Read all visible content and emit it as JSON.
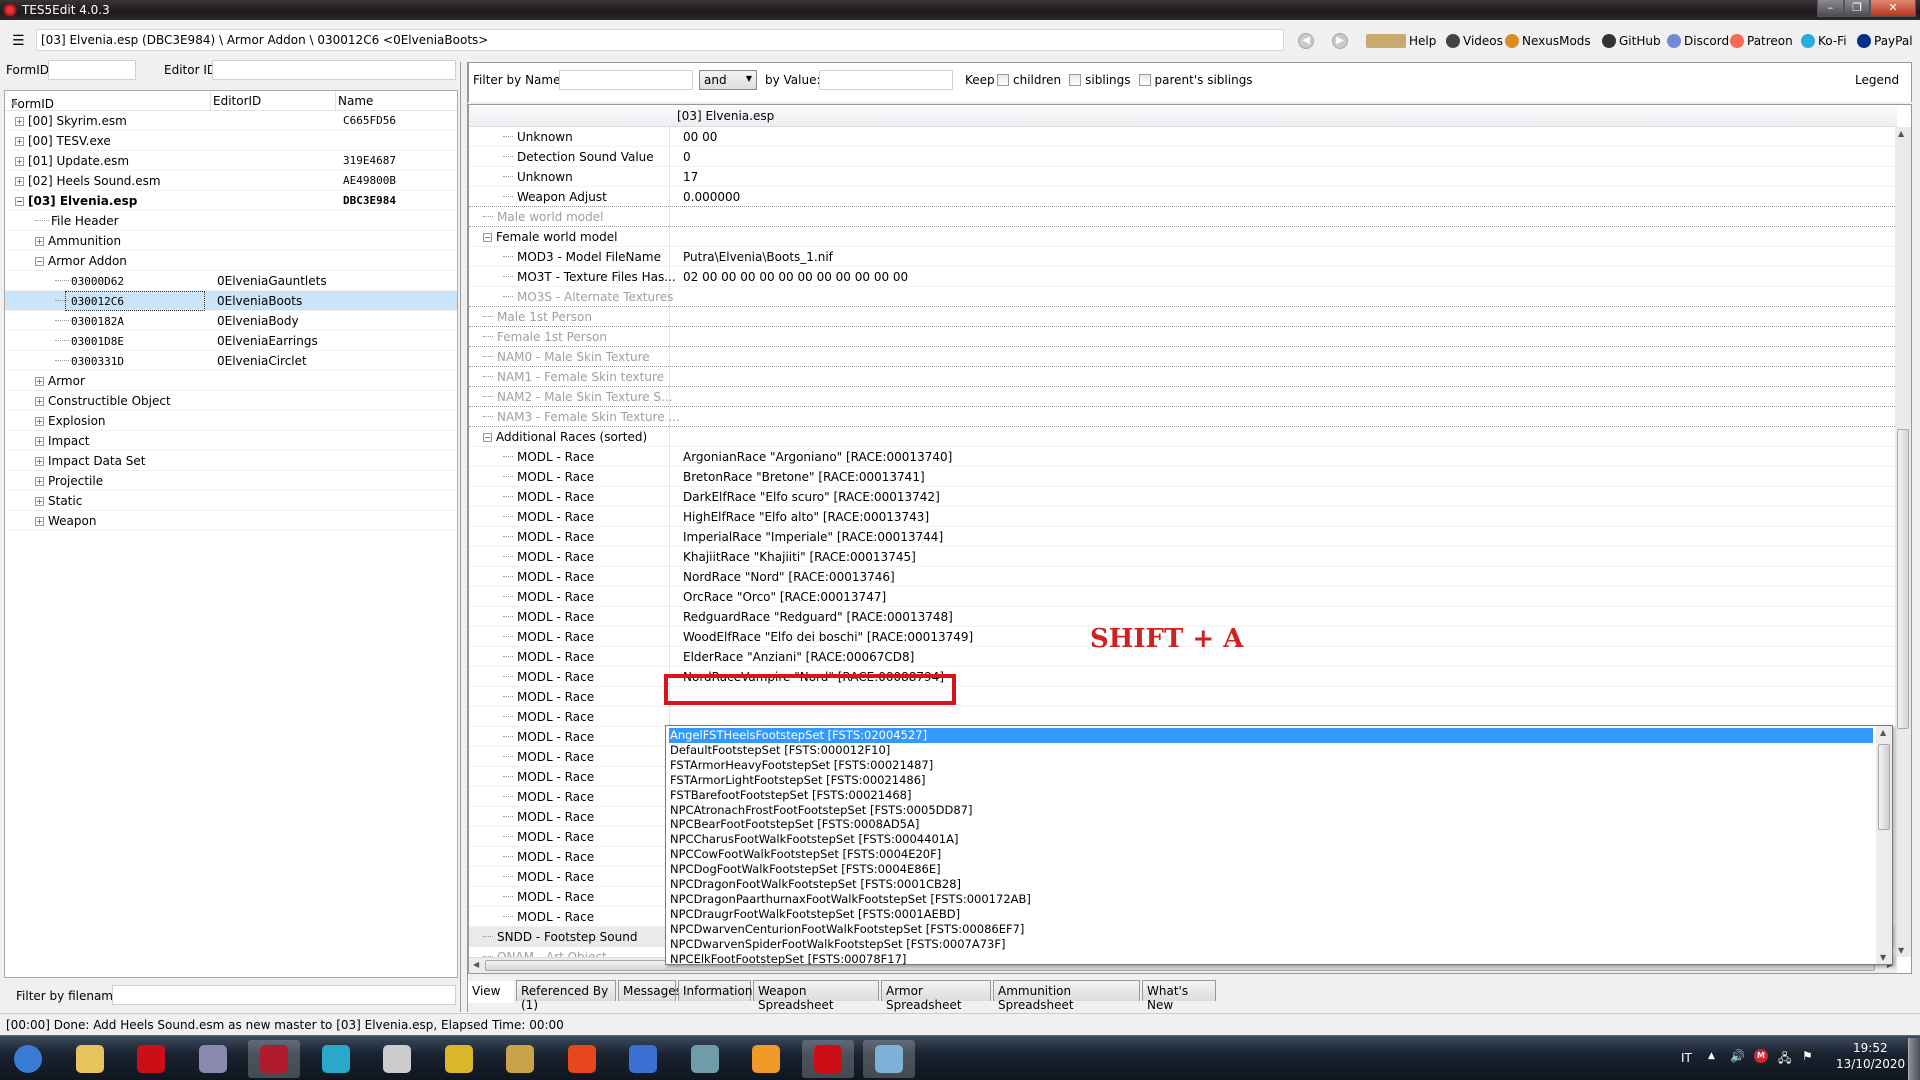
{
  "window": {
    "title": "TES5Edit 4.0.3"
  },
  "toolbar": {
    "path": "[03] Elvenia.esp (DBC3E984) \\ Armor Addon \\ 030012C6 <0ElveniaBoots>",
    "menu_glyph": "☰",
    "back_glyph": "◀",
    "forward_glyph": "▶",
    "links": [
      {
        "label": "Help",
        "icon": "book-icon",
        "color": "#c8a96e"
      },
      {
        "label": "Videos",
        "icon": "videos-icon",
        "color": "#444444"
      },
      {
        "label": "NexusMods",
        "icon": "nexusmods-icon",
        "color": "#d98c1f"
      },
      {
        "label": "GitHub",
        "icon": "github-icon",
        "color": "#333333"
      },
      {
        "label": "Discord",
        "icon": "discord-icon",
        "color": "#7289da"
      },
      {
        "label": "Patreon",
        "icon": "patreon-icon",
        "color": "#f96854"
      },
      {
        "label": "Ko-Fi",
        "icon": "kofi-icon",
        "color": "#29abe0"
      },
      {
        "label": "PayPal",
        "icon": "paypal-icon",
        "color": "#003087"
      }
    ]
  },
  "left": {
    "formid_label": "FormID",
    "editorid_label": "Editor ID",
    "formid_value": "",
    "editorid_value": "",
    "columns": [
      "FormID",
      "EditorID",
      "Name"
    ],
    "sort_glyph": "▲",
    "rows": [
      {
        "indent": 0,
        "exp": "+",
        "label": "[00] Skyrim.esm",
        "editor": "",
        "name": "C665FD56"
      },
      {
        "indent": 0,
        "exp": "+",
        "label": "[00] TESV.exe",
        "editor": "",
        "name": ""
      },
      {
        "indent": 0,
        "exp": "+",
        "label": "[01] Update.esm",
        "editor": "",
        "name": "319E4687"
      },
      {
        "indent": 0,
        "exp": "+",
        "label": "[02] Heels Sound.esm",
        "editor": "",
        "name": "AE49800B"
      },
      {
        "indent": 0,
        "exp": "-",
        "label": "[03] Elvenia.esp",
        "editor": "",
        "name": "DBC3E984",
        "bold": true
      },
      {
        "indent": 1,
        "exp": "",
        "label": "File Header",
        "editor": "",
        "name": ""
      },
      {
        "indent": 1,
        "exp": "+",
        "label": "Ammunition",
        "editor": "",
        "name": ""
      },
      {
        "indent": 1,
        "exp": "-",
        "label": "Armor Addon",
        "editor": "",
        "name": ""
      },
      {
        "indent": 2,
        "exp": "",
        "label": "03000D62",
        "editor": "0ElveniaGauntlets",
        "name": "",
        "mono": true
      },
      {
        "indent": 2,
        "exp": "",
        "label": "030012C6",
        "editor": "0ElveniaBoots",
        "name": "",
        "mono": true,
        "selected": true
      },
      {
        "indent": 2,
        "exp": "",
        "label": "0300182A",
        "editor": "0ElveniaBody",
        "name": "",
        "mono": true
      },
      {
        "indent": 2,
        "exp": "",
        "label": "03001D8E",
        "editor": "0ElveniaEarrings",
        "name": "",
        "mono": true
      },
      {
        "indent": 2,
        "exp": "",
        "label": "0300331D",
        "editor": "0ElveniaCirclet",
        "name": "",
        "mono": true
      },
      {
        "indent": 1,
        "exp": "+",
        "label": "Armor",
        "editor": "",
        "name": ""
      },
      {
        "indent": 1,
        "exp": "+",
        "label": "Constructible Object",
        "editor": "",
        "name": ""
      },
      {
        "indent": 1,
        "exp": "+",
        "label": "Explosion",
        "editor": "",
        "name": ""
      },
      {
        "indent": 1,
        "exp": "+",
        "label": "Impact",
        "editor": "",
        "name": ""
      },
      {
        "indent": 1,
        "exp": "+",
        "label": "Impact Data Set",
        "editor": "",
        "name": ""
      },
      {
        "indent": 1,
        "exp": "+",
        "label": "Projectile",
        "editor": "",
        "name": ""
      },
      {
        "indent": 1,
        "exp": "+",
        "label": "Static",
        "editor": "",
        "name": ""
      },
      {
        "indent": 1,
        "exp": "+",
        "label": "Weapon",
        "editor": "",
        "name": ""
      }
    ],
    "filter_label": "Filter by filename:",
    "filter_value": ""
  },
  "right": {
    "filter_name_label": "Filter by Name:",
    "filter_name_value": "",
    "combinator": "and",
    "filter_value_label": "by Value:",
    "filter_value_value": "",
    "keep_label": "Keep",
    "checkboxes": [
      {
        "label": "children",
        "checked": false
      },
      {
        "label": "siblings",
        "checked": false
      },
      {
        "label": "parent's siblings",
        "checked": false
      }
    ],
    "legend_label": "Legend",
    "column_header": "[03] Elvenia.esp",
    "rows": [
      {
        "indent": 2,
        "name": "Unknown",
        "value": "00 00"
      },
      {
        "indent": 2,
        "name": "Detection Sound Value",
        "value": "0"
      },
      {
        "indent": 2,
        "name": "Unknown",
        "value": "17"
      },
      {
        "indent": 2,
        "name": "Weapon Adjust",
        "value": "0.000000",
        "sep": true
      },
      {
        "indent": 1,
        "name": "Male world model",
        "value": "",
        "dim": true,
        "sep": true
      },
      {
        "indent": 1,
        "name": "Female world model",
        "value": "",
        "exp": "-"
      },
      {
        "indent": 2,
        "name": "MOD3 - Model FileName",
        "value": "Putra\\Elvenia\\Boots_1.nif"
      },
      {
        "indent": 2,
        "name": "MO3T - Texture Files Has...",
        "value": "02 00 00 00 00 00 00 00 00 00 00 00"
      },
      {
        "indent": 2,
        "name": "MO3S - Alternate Textures",
        "value": "",
        "dim": true,
        "sep": true
      },
      {
        "indent": 1,
        "name": "Male 1st Person",
        "value": "",
        "dim": true,
        "sep": true
      },
      {
        "indent": 1,
        "name": "Female 1st Person",
        "value": "",
        "dim": true,
        "sep": true
      },
      {
        "indent": 1,
        "name": "NAM0 - Male Skin Texture",
        "value": "",
        "dim": true,
        "sep": true
      },
      {
        "indent": 1,
        "name": "NAM1 - Female Skin texture",
        "value": "",
        "dim": true,
        "sep": true
      },
      {
        "indent": 1,
        "name": "NAM2 - Male Skin Texture S...",
        "value": "",
        "dim": true,
        "sep": true
      },
      {
        "indent": 1,
        "name": "NAM3 - Female Skin Texture ...",
        "value": "",
        "dim": true,
        "sep": true
      },
      {
        "indent": 1,
        "name": "Additional Races (sorted)",
        "value": "",
        "exp": "-"
      },
      {
        "indent": 2,
        "name": "MODL - Race",
        "value": "ArgonianRace \"Argoniano\" [RACE:00013740]"
      },
      {
        "indent": 2,
        "name": "MODL - Race",
        "value": "BretonRace \"Bretone\" [RACE:00013741]"
      },
      {
        "indent": 2,
        "name": "MODL - Race",
        "value": "DarkElfRace \"Elfo scuro\" [RACE:00013742]"
      },
      {
        "indent": 2,
        "name": "MODL - Race",
        "value": "HighElfRace \"Elfo alto\" [RACE:00013743]"
      },
      {
        "indent": 2,
        "name": "MODL - Race",
        "value": "ImperialRace \"Imperiale\" [RACE:00013744]"
      },
      {
        "indent": 2,
        "name": "MODL - Race",
        "value": "KhajiitRace \"Khajiiti\" [RACE:00013745]"
      },
      {
        "indent": 2,
        "name": "MODL - Race",
        "value": "NordRace \"Nord\" [RACE:00013746]"
      },
      {
        "indent": 2,
        "name": "MODL - Race",
        "value": "OrcRace \"Orco\" [RACE:00013747]"
      },
      {
        "indent": 2,
        "name": "MODL - Race",
        "value": "RedguardRace \"Redguard\" [RACE:00013748]"
      },
      {
        "indent": 2,
        "name": "MODL - Race",
        "value": "WoodElfRace \"Elfo dei boschi\" [RACE:00013749]"
      },
      {
        "indent": 2,
        "name": "MODL - Race",
        "value": "ElderRace \"Anziani\" [RACE:00067CD8]"
      },
      {
        "indent": 2,
        "name": "MODL - Race",
        "value": "NordRaceVampire \"Nord\" [RACE:00088794]"
      },
      {
        "indent": 2,
        "name": "MODL - Race",
        "value": ""
      },
      {
        "indent": 2,
        "name": "MODL - Race",
        "value": ""
      },
      {
        "indent": 2,
        "name": "MODL - Race",
        "value": ""
      },
      {
        "indent": 2,
        "name": "MODL - Race",
        "value": ""
      },
      {
        "indent": 2,
        "name": "MODL - Race",
        "value": ""
      },
      {
        "indent": 2,
        "name": "MODL - Race",
        "value": ""
      },
      {
        "indent": 2,
        "name": "MODL - Race",
        "value": ""
      },
      {
        "indent": 2,
        "name": "MODL - Race",
        "value": ""
      },
      {
        "indent": 2,
        "name": "MODL - Race",
        "value": ""
      },
      {
        "indent": 2,
        "name": "MODL - Race",
        "value": ""
      },
      {
        "indent": 2,
        "name": "MODL - Race",
        "value": ""
      },
      {
        "indent": 2,
        "name": "MODL - Race",
        "value": ""
      },
      {
        "indent": 1,
        "name": "SNDD - Footstep Sound",
        "value": "",
        "editing": true
      },
      {
        "indent": 1,
        "name": "ONAM - Art Object",
        "value": "",
        "dim": true
      }
    ],
    "editor": {
      "typed": "A",
      "selected_text": "ngelFSTHeelsFootstepSet [FSTS:02004527]"
    },
    "dropdown": [
      "AngelFSTHeelsFootstepSet [FSTS:02004527]",
      "DefaultFootstepSet [FSTS:000012F10]",
      "FSTArmorHeavyFootstepSet [FSTS:00021487]",
      "FSTArmorLightFootstepSet [FSTS:00021486]",
      "FSTBarefootFootstepSet [FSTS:00021468]",
      "NPCAtronachFrostFootFootstepSet [FSTS:0005DD87]",
      "NPCBearFootFootstepSet [FSTS:0008AD5A]",
      "NPCCharusFootWalkFootstepSet [FSTS:0004401A]",
      "NPCCowFootWalkFootstepSet [FSTS:0004E20F]",
      "NPCDogFootWalkFootstepSet [FSTS:0004E86E]",
      "NPCDragonFootWalkFootstepSet [FSTS:0001CB28]",
      "NPCDragonPaarthurnaxFootWalkFootstepSet [FSTS:000172AB]",
      "NPCDraugrFootWalkFootstepSet [FSTS:0001AEBD]",
      "NPCDwarvenCenturionFootWalkFootstepSet [FSTS:00086EF7]",
      "NPCDwarvenSpiderFootWalkFootstepSet [FSTS:0007A73F]",
      "NPCElkFootFootstepSet [FSTS:00078F17]"
    ],
    "dropdown_highlight_index": 0,
    "annotation": "SHIFT + A",
    "annotation_color": "#d02020",
    "tabs": [
      "View",
      "Referenced By (1)",
      "Messages",
      "Information",
      "Weapon Spreadsheet",
      "Armor Spreadsheet",
      "Ammunition Spreadsheet",
      "What's New"
    ],
    "active_tab": 0
  },
  "status": "[00:00] Done: Add Heels Sound.esm as new master to [03] Elvenia.esp, Elapsed Time: 00:00",
  "taskbar": {
    "apps": [
      {
        "name": "start-button",
        "color": "#3a7bd5"
      },
      {
        "name": "explorer",
        "color": "#e8c25a"
      },
      {
        "name": "opera",
        "color": "#cc0f16"
      },
      {
        "name": "monitor-app",
        "color": "#8a8ab0"
      },
      {
        "name": "tes5edit",
        "color": "#b01b2e",
        "active": true
      },
      {
        "name": "music-app",
        "color": "#2aa7c9"
      },
      {
        "name": "audio-app",
        "color": "#cccccc"
      },
      {
        "name": "archive-app",
        "color": "#d9b62a"
      },
      {
        "name": "shape-app",
        "color": "#c9a24a"
      },
      {
        "name": "f-app",
        "color": "#e8461c"
      },
      {
        "name": "ffdec",
        "color": "#3b6fd1"
      },
      {
        "name": "window-app",
        "color": "#6f9ca8"
      },
      {
        "name": "x-app",
        "color": "#f09a2a"
      },
      {
        "name": "opera-2",
        "color": "#cc0f16",
        "active": true
      },
      {
        "name": "paint-app",
        "color": "#7fb0d8",
        "active": true
      }
    ],
    "lang": "IT",
    "time": "19:52",
    "date": "13/10/2020"
  }
}
